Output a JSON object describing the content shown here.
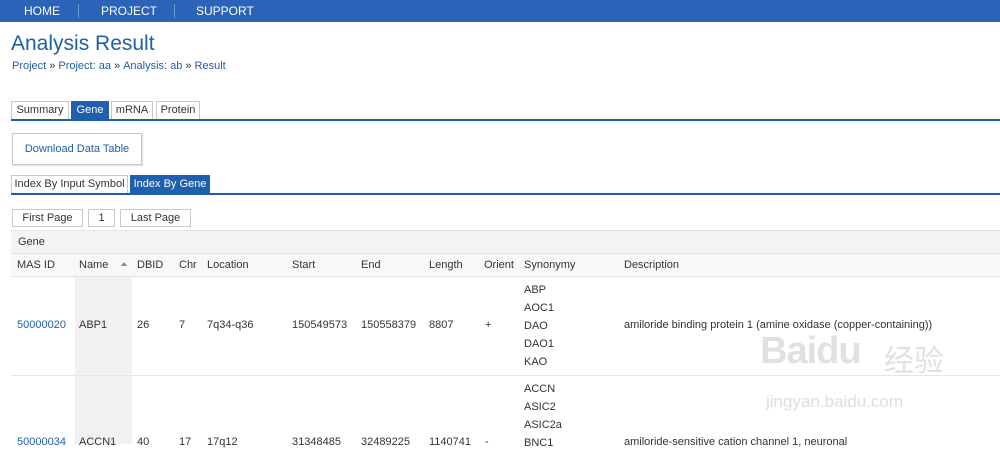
{
  "nav": {
    "items": [
      "HOME",
      "PROJECT",
      "SUPPORT"
    ]
  },
  "page": {
    "title": "Analysis Result",
    "breadcrumb": [
      "Project",
      "Project: aa",
      "Analysis: ab",
      "Result"
    ]
  },
  "tabs": {
    "items": [
      "Summary",
      "Gene",
      "mRNA",
      "Protein"
    ],
    "active": "Gene"
  },
  "download_button": "Download Data Table",
  "subtabs": {
    "items": [
      "Index By Input Symbol",
      "Index By Gene"
    ],
    "active": "Index By Gene"
  },
  "pager": {
    "first": "First Page",
    "page": "1",
    "last": "Last Page"
  },
  "table": {
    "group_header": "Gene",
    "columns": [
      "MAS ID",
      "Name",
      "DBID",
      "Chr",
      "Location",
      "Start",
      "End",
      "Length",
      "Orient",
      "Synonymy",
      "Description"
    ],
    "sorted_column": "Name",
    "rows": [
      {
        "mas_id": "50000020",
        "name": "ABP1",
        "dbid": "26",
        "chr": "7",
        "location": "7q34-q36",
        "start": "150549573",
        "end": "150558379",
        "length": "8807",
        "orient": "+",
        "synonymy": [
          "ABP",
          "AOC1",
          "DAO",
          "DAO1",
          "KAO"
        ],
        "description": "amiloride binding protein 1 (amine oxidase (copper-containing))"
      },
      {
        "mas_id": "50000034",
        "name": "ACCN1",
        "dbid": "40",
        "chr": "17",
        "location": "17q12",
        "start": "31348485",
        "end": "32489225",
        "length": "1140741",
        "orient": "-",
        "synonymy": [
          "ACCN",
          "ASIC2",
          "ASIC2a",
          "BNC1"
        ],
        "description": "amiloride-sensitive cation channel 1, neuronal"
      }
    ]
  },
  "watermark": {
    "logo": "Baidu",
    "cn": "经验",
    "url": "jingyan.baidu.com"
  }
}
